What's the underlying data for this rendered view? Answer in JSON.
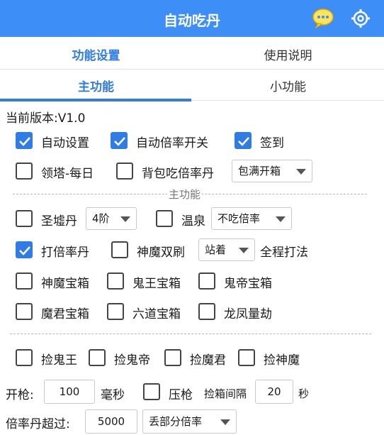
{
  "header": {
    "title": "自动吃丹",
    "chat_icon": "chat-bubble-icon",
    "settings_icon": "gear-icon"
  },
  "tabs_top": [
    {
      "label": "功能设置",
      "active": true
    },
    {
      "label": "使用说明",
      "active": false
    }
  ],
  "tabs_sub": [
    {
      "label": "主功能",
      "active": true
    },
    {
      "label": "小功能",
      "active": false
    }
  ],
  "version_text": "当前版本:V1.0",
  "row1": [
    {
      "label": "自动设置",
      "checked": true
    },
    {
      "label": "自动倍率开关",
      "checked": true
    },
    {
      "label": "签到",
      "checked": true
    }
  ],
  "row2": {
    "lingta": {
      "label": "领塔-每日",
      "checked": false
    },
    "beibao": {
      "label": "背包吃倍率丹",
      "checked": false
    },
    "beibao_select": "包满开箱"
  },
  "section_main": "主功能",
  "row3": {
    "shengxu": {
      "label": "圣墟丹",
      "checked": false
    },
    "shengxu_select": "4阶",
    "wenquan": {
      "label": "温泉",
      "checked": false
    },
    "wenquan_select": "不吃倍率"
  },
  "row4": {
    "dabeilv": {
      "label": "打倍率丹",
      "checked": true
    },
    "shenmo": {
      "label": "神魔双刷",
      "checked": false
    },
    "shenmo_select": "站着",
    "after": "全程打法"
  },
  "row5": [
    {
      "label": "神魔宝箱",
      "checked": false
    },
    {
      "label": "鬼王宝箱",
      "checked": false
    },
    {
      "label": "鬼帝宝箱",
      "checked": false
    }
  ],
  "row6": [
    {
      "label": "魔君宝箱",
      "checked": false
    },
    {
      "label": "六道宝箱",
      "checked": false
    },
    {
      "label": "龙凤量劫",
      "checked": false
    }
  ],
  "row7": [
    {
      "label": "捡鬼王",
      "checked": false
    },
    {
      "label": "捡鬼帝",
      "checked": false
    },
    {
      "label": "捡魔君",
      "checked": false
    },
    {
      "label": "捡神魔",
      "checked": false
    }
  ],
  "row8": {
    "kaiqiang_label": "开枪:",
    "kaiqiang_value": "100",
    "ms_label": "毫秒",
    "yaqiang": {
      "label": "压枪",
      "checked": false
    },
    "interval_label": "捡箱间隔",
    "interval_value": "20",
    "sec_label": "秒"
  },
  "row9": {
    "label": "倍率丹超过:",
    "value": "5000",
    "select": "丢部分倍率"
  },
  "colors": {
    "accent": "#3e8ef7",
    "tab_active": "#2f7ce6"
  }
}
